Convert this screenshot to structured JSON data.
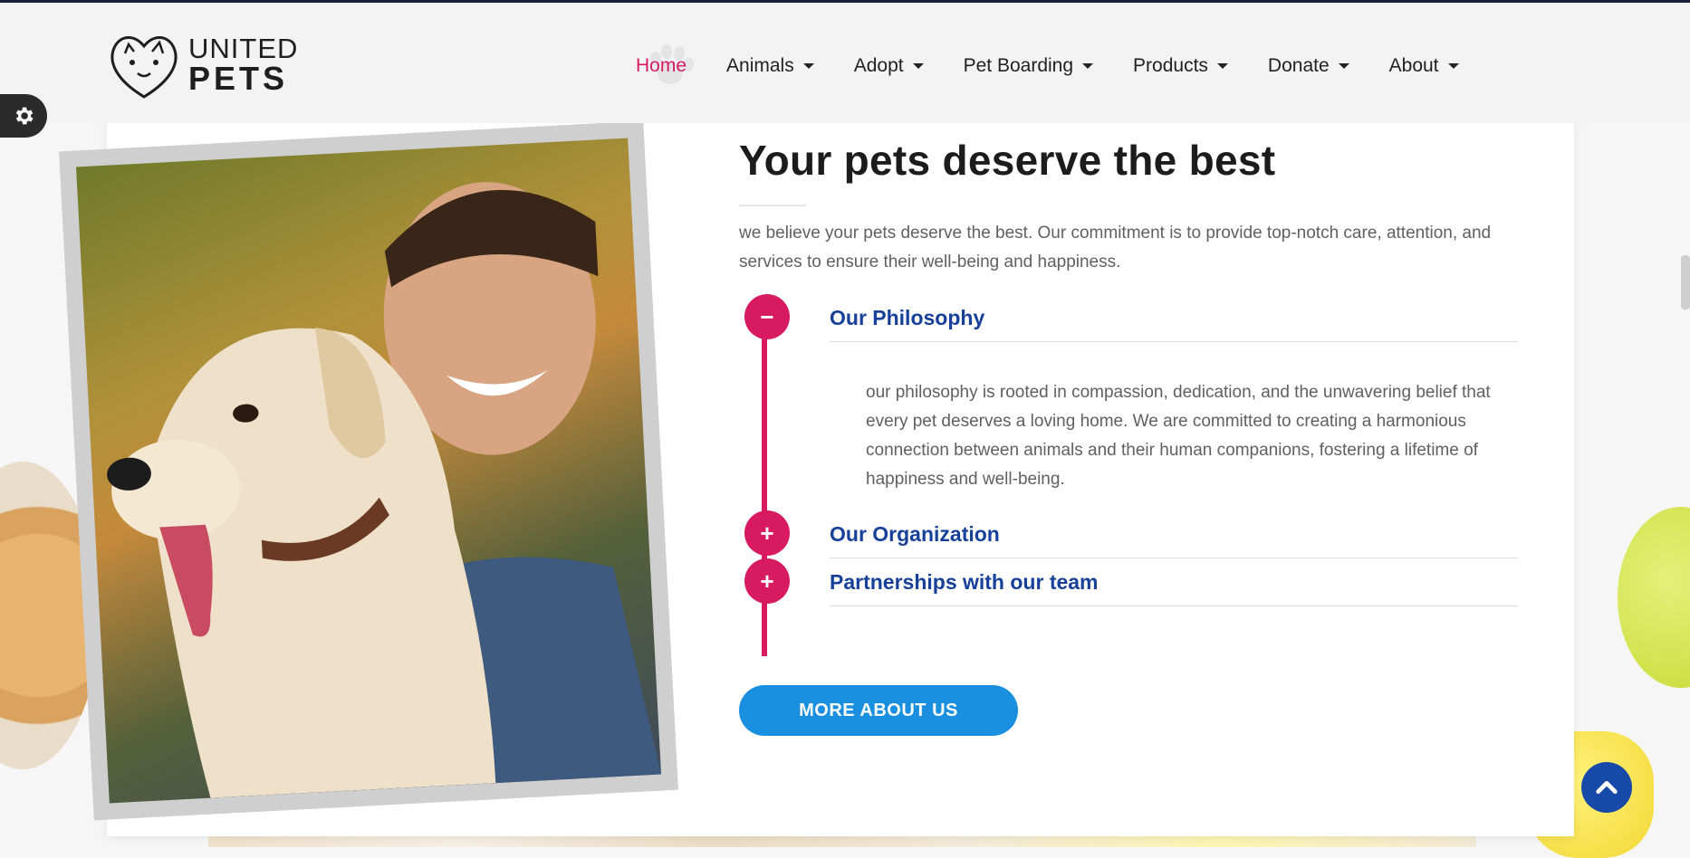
{
  "brand": {
    "line1": "UNITED",
    "line2": "PETS"
  },
  "nav": {
    "items": [
      {
        "label": "Home",
        "active": true,
        "dropdown": false
      },
      {
        "label": "Animals",
        "dropdown": true
      },
      {
        "label": "Adopt",
        "dropdown": true
      },
      {
        "label": "Pet Boarding",
        "dropdown": true
      },
      {
        "label": "Products",
        "dropdown": true
      },
      {
        "label": "Donate",
        "dropdown": true
      },
      {
        "label": "About",
        "dropdown": true
      }
    ]
  },
  "main": {
    "title": "Your pets deserve the best",
    "intro": "we believe your pets deserve the best. Our commitment is to provide top-notch care, attention, and services to ensure their well-being and happiness.",
    "accordion": [
      {
        "title": "Our Philosophy",
        "expanded": true,
        "toggle_symbol": "−",
        "body": "our philosophy is rooted in compassion, dedication, and the unwavering belief that every pet deserves a loving home. We are committed to creating a harmonious connection between animals and their human companions, fostering a lifetime of happiness and well-being."
      },
      {
        "title": "Our Organization",
        "expanded": false,
        "toggle_symbol": "+"
      },
      {
        "title": "Partnerships with our team",
        "expanded": false,
        "toggle_symbol": "+"
      }
    ],
    "cta_label": "MORE ABOUT US"
  },
  "colors": {
    "accent_pink": "#d81b60",
    "heading_blue": "#16409a",
    "button_blue": "#1a8fe0",
    "to_top_blue": "#1649a8"
  },
  "icons": {
    "settings": "gear-icon",
    "to_top": "chevron-up-icon",
    "logo": "cat-dog-heart-logo",
    "nav_active_decoration": "paw-icon"
  }
}
